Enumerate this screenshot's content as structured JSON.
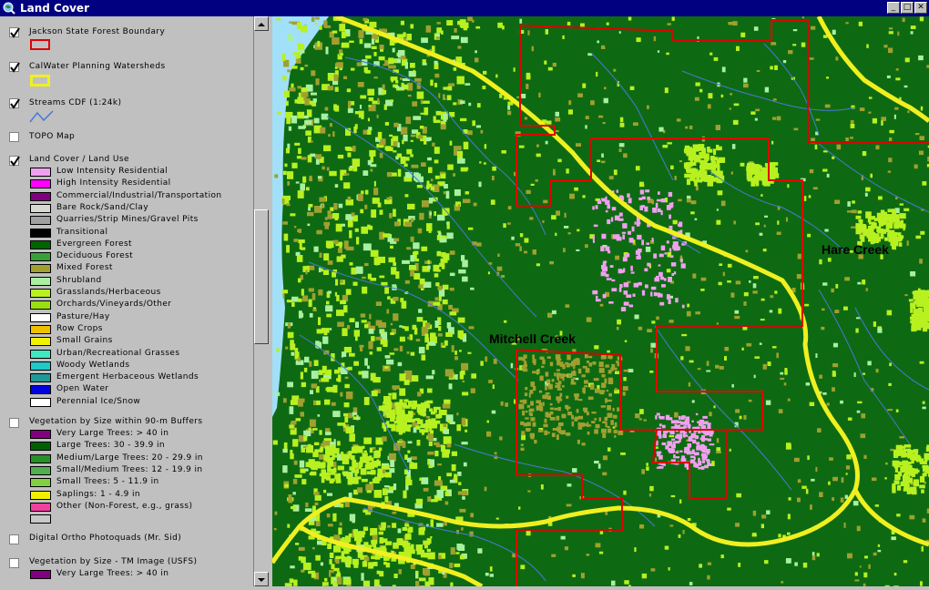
{
  "window": {
    "title": "Land Cover",
    "buttons": [
      "_",
      "□",
      "✕"
    ]
  },
  "legend": {
    "layers": [
      {
        "name": "Jackson State Forest Boundary",
        "checked": true
      },
      {
        "name": "CalWater Planning Watersheds",
        "checked": true
      },
      {
        "name": "Streams CDF (1:24k)",
        "checked": true
      },
      {
        "name": "TOPO Map",
        "checked": false
      },
      {
        "name": "Land Cover / Land Use",
        "checked": true
      },
      {
        "name": "Vegetation by Size within 90-m Buffers",
        "checked": false
      },
      {
        "name": "Digital Ortho Photoquads (Mr. Sid)",
        "checked": false
      },
      {
        "name": "Vegetation by Size - TM Image (USFS)",
        "checked": false
      }
    ],
    "land_cover_classes": [
      {
        "label": "Low Intensity Residential",
        "color": "#f0a0f0"
      },
      {
        "label": "High Intensity Residential",
        "color": "#ff00ff"
      },
      {
        "label": "Commercial/Industrial/Transportation",
        "color": "#800080"
      },
      {
        "label": "Bare Rock/Sand/Clay",
        "color": "#d8d8d0"
      },
      {
        "label": "Quarries/Strip Mines/Gravel Pits",
        "color": "#a0a0a0"
      },
      {
        "label": "Transitional",
        "color": "#000000"
      },
      {
        "label": "Evergreen Forest",
        "color": "#006400"
      },
      {
        "label": "Deciduous Forest",
        "color": "#38a038"
      },
      {
        "label": "Mixed Forest",
        "color": "#a0a030"
      },
      {
        "label": "Shrubland",
        "color": "#a8f0a0"
      },
      {
        "label": "Grasslands/Herbaceous",
        "color": "#b8f020"
      },
      {
        "label": "Orchards/Vineyards/Other",
        "color": "#98e010"
      },
      {
        "label": "Pasture/Hay",
        "color": "#ffffff"
      },
      {
        "label": "Row Crops",
        "color": "#f0c000"
      },
      {
        "label": "Small Grains",
        "color": "#f0f000"
      },
      {
        "label": "Urban/Recreational Grasses",
        "color": "#40e8c0"
      },
      {
        "label": "Woody Wetlands",
        "color": "#20c8c8"
      },
      {
        "label": "Emergent Herbaceous Wetlands",
        "color": "#209898"
      },
      {
        "label": "Open Water",
        "color": "#0000e0"
      },
      {
        "label": "Perennial Ice/Snow",
        "color": "#ffffff"
      }
    ],
    "veg_buffer_classes": [
      {
        "label": "Very Large Trees: > 40  in",
        "color": "#800080"
      },
      {
        "label": "Large Trees: 30 - 39.9 in",
        "color": "#006000"
      },
      {
        "label": "Medium/Large Trees: 20 - 29.9 in",
        "color": "#289028"
      },
      {
        "label": "Small/Medium Trees: 12 - 19.9 in",
        "color": "#50b050"
      },
      {
        "label": "Small Trees: 5 - 11.9 in",
        "color": "#80d040"
      },
      {
        "label": "Saplings: 1 - 4.9 in",
        "color": "#f0f000"
      },
      {
        "label": "Other (Non-Forest, e.g., grass)",
        "color": "#f040a0"
      },
      {
        "label": "",
        "color": "#c8c8c8"
      }
    ],
    "veg_tm_classes": [
      {
        "label": "Very Large Trees: > 40  in",
        "color": "#800080"
      }
    ]
  },
  "map": {
    "labels": {
      "mitchell": "Mitchell Creek",
      "hare": "Hare Creek"
    },
    "colors": {
      "evergreen": "#0e6a12",
      "boundary": "#e00000",
      "watershed": "#f0f020",
      "stream": "#4878d8",
      "grass": "#b8f020",
      "mixed": "#a0a030",
      "shrub": "#a8f0a0",
      "residential": "#f0a0f0",
      "ocean": "#a0e0f8"
    }
  }
}
